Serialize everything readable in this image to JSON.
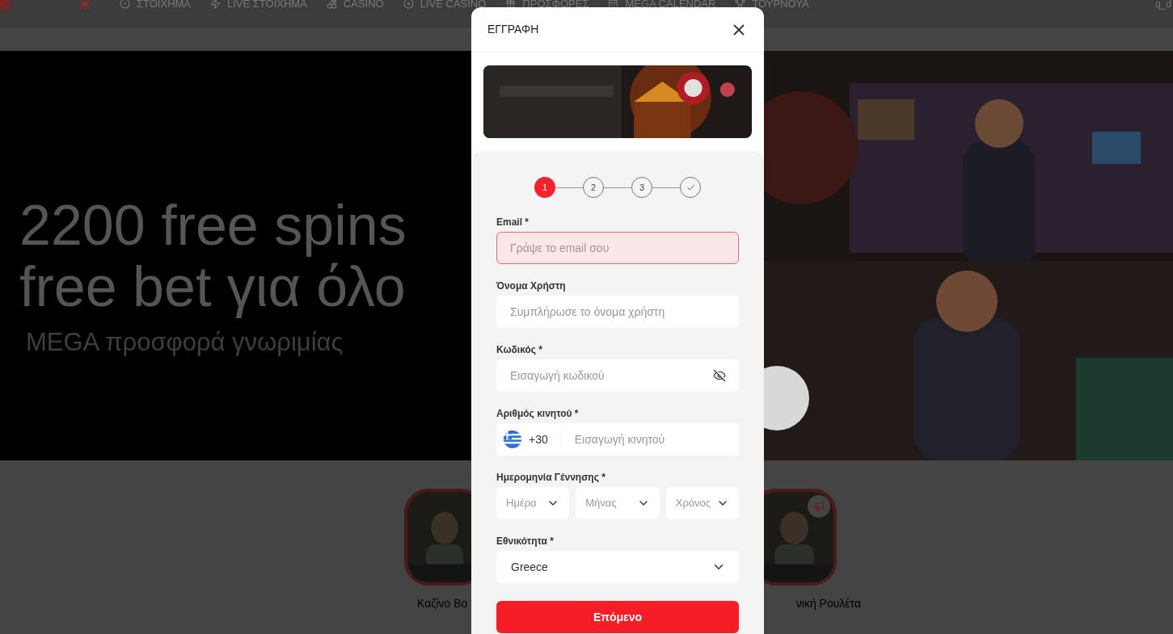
{
  "nav": {
    "items": [
      {
        "label": "ΣΤΟΙΧΗΜΑ",
        "kind": "ball"
      },
      {
        "label": "LIVE ΣΤΟΙΧΗΜΑ",
        "kind": "bolt"
      },
      {
        "label": "CASINO",
        "kind": "cherry"
      },
      {
        "label": "LIVE CASINO",
        "kind": "chip"
      },
      {
        "label": "ΠΡΟΣΦΟΡΕΣ",
        "kind": "gift"
      },
      {
        "label": "MEGA CALENDAR",
        "kind": "calendar"
      },
      {
        "label": "ΤΟΥΡΝΟΥΑ",
        "kind": "trophy"
      }
    ],
    "user": "q_d"
  },
  "hero": {
    "lines": [
      "2200 free spins",
      "free bet για όλο"
    ],
    "subtitle": "MEGA προσφορά γνωριμίας"
  },
  "games": [
    {
      "title": "Καζίνο Βο"
    },
    {
      "title": "νική Ρουλέτα"
    }
  ],
  "modal": {
    "title": "ΕΓΓΡΑΦΗ",
    "steps": [
      {
        "kind": "number",
        "label": "1",
        "selected": true
      },
      {
        "kind": "number",
        "label": "2",
        "selected": false
      },
      {
        "kind": "number",
        "label": "3",
        "selected": false
      },
      {
        "kind": "check",
        "selected": false
      }
    ],
    "fields": [
      {
        "kind": "text",
        "label": "Email *",
        "placeholder": "Γράψε το email σου",
        "invalid": true
      },
      {
        "kind": "text",
        "label": "Όνομα Χρήστη",
        "placeholder": "Συμπλήρωσε το όνομα χρήστη",
        "invalid": false
      },
      {
        "kind": "password",
        "label": "Κωδικός *",
        "placeholder": "Εισαγωγή κωδικού",
        "invalid": false
      },
      {
        "kind": "phone",
        "label": "Αριθμός κινητού *",
        "prefix": "+30",
        "placeholder": "Εισαγωγή κινητού",
        "invalid": false
      },
      {
        "kind": "date",
        "label": "Ημερομηνία Γέννησης *",
        "parts": [
          "Ημέρα",
          "Μήνας",
          "Χρόνος"
        ]
      },
      {
        "kind": "select",
        "label": "Εθνικότητα *",
        "value": "Greece"
      }
    ],
    "submit": "Επόμενο"
  }
}
